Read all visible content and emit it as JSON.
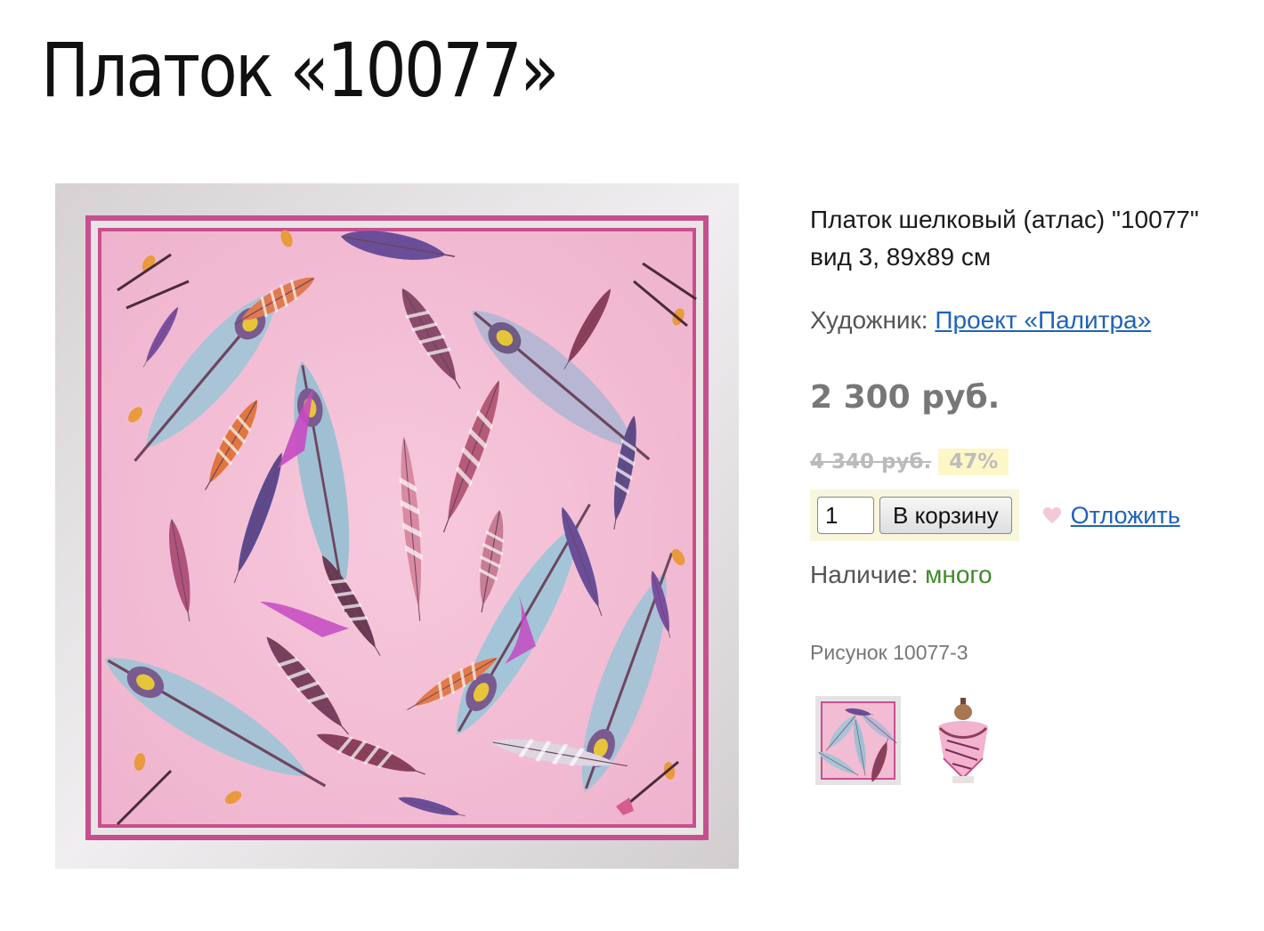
{
  "page": {
    "title": "Платок «10077»"
  },
  "product": {
    "description": "Платок шелковый (атлас) \"10077\" вид 3, 89x89 см",
    "artist_label": "Художник:",
    "artist_name": "Проект «Палитра»",
    "price": "2 300 руб.",
    "old_price": "4 340 руб.",
    "discount": "47%",
    "quantity": "1",
    "cart_button": "В корзину",
    "wishlist_link": "Отложить",
    "stock_label": "Наличие:",
    "stock_value": "много",
    "picture_label": "Рисунок 10077-3"
  },
  "colors": {
    "link": "#1f63b8",
    "price": "#777777",
    "stock": "#3e8a2a",
    "discount_bg": "#fdf7c8",
    "cart_bg": "#f8f6dc",
    "scarf_pink": "#f2b9d2",
    "scarf_border": "#d8d4d6"
  },
  "icons": {
    "wishlist": "heart-icon"
  }
}
